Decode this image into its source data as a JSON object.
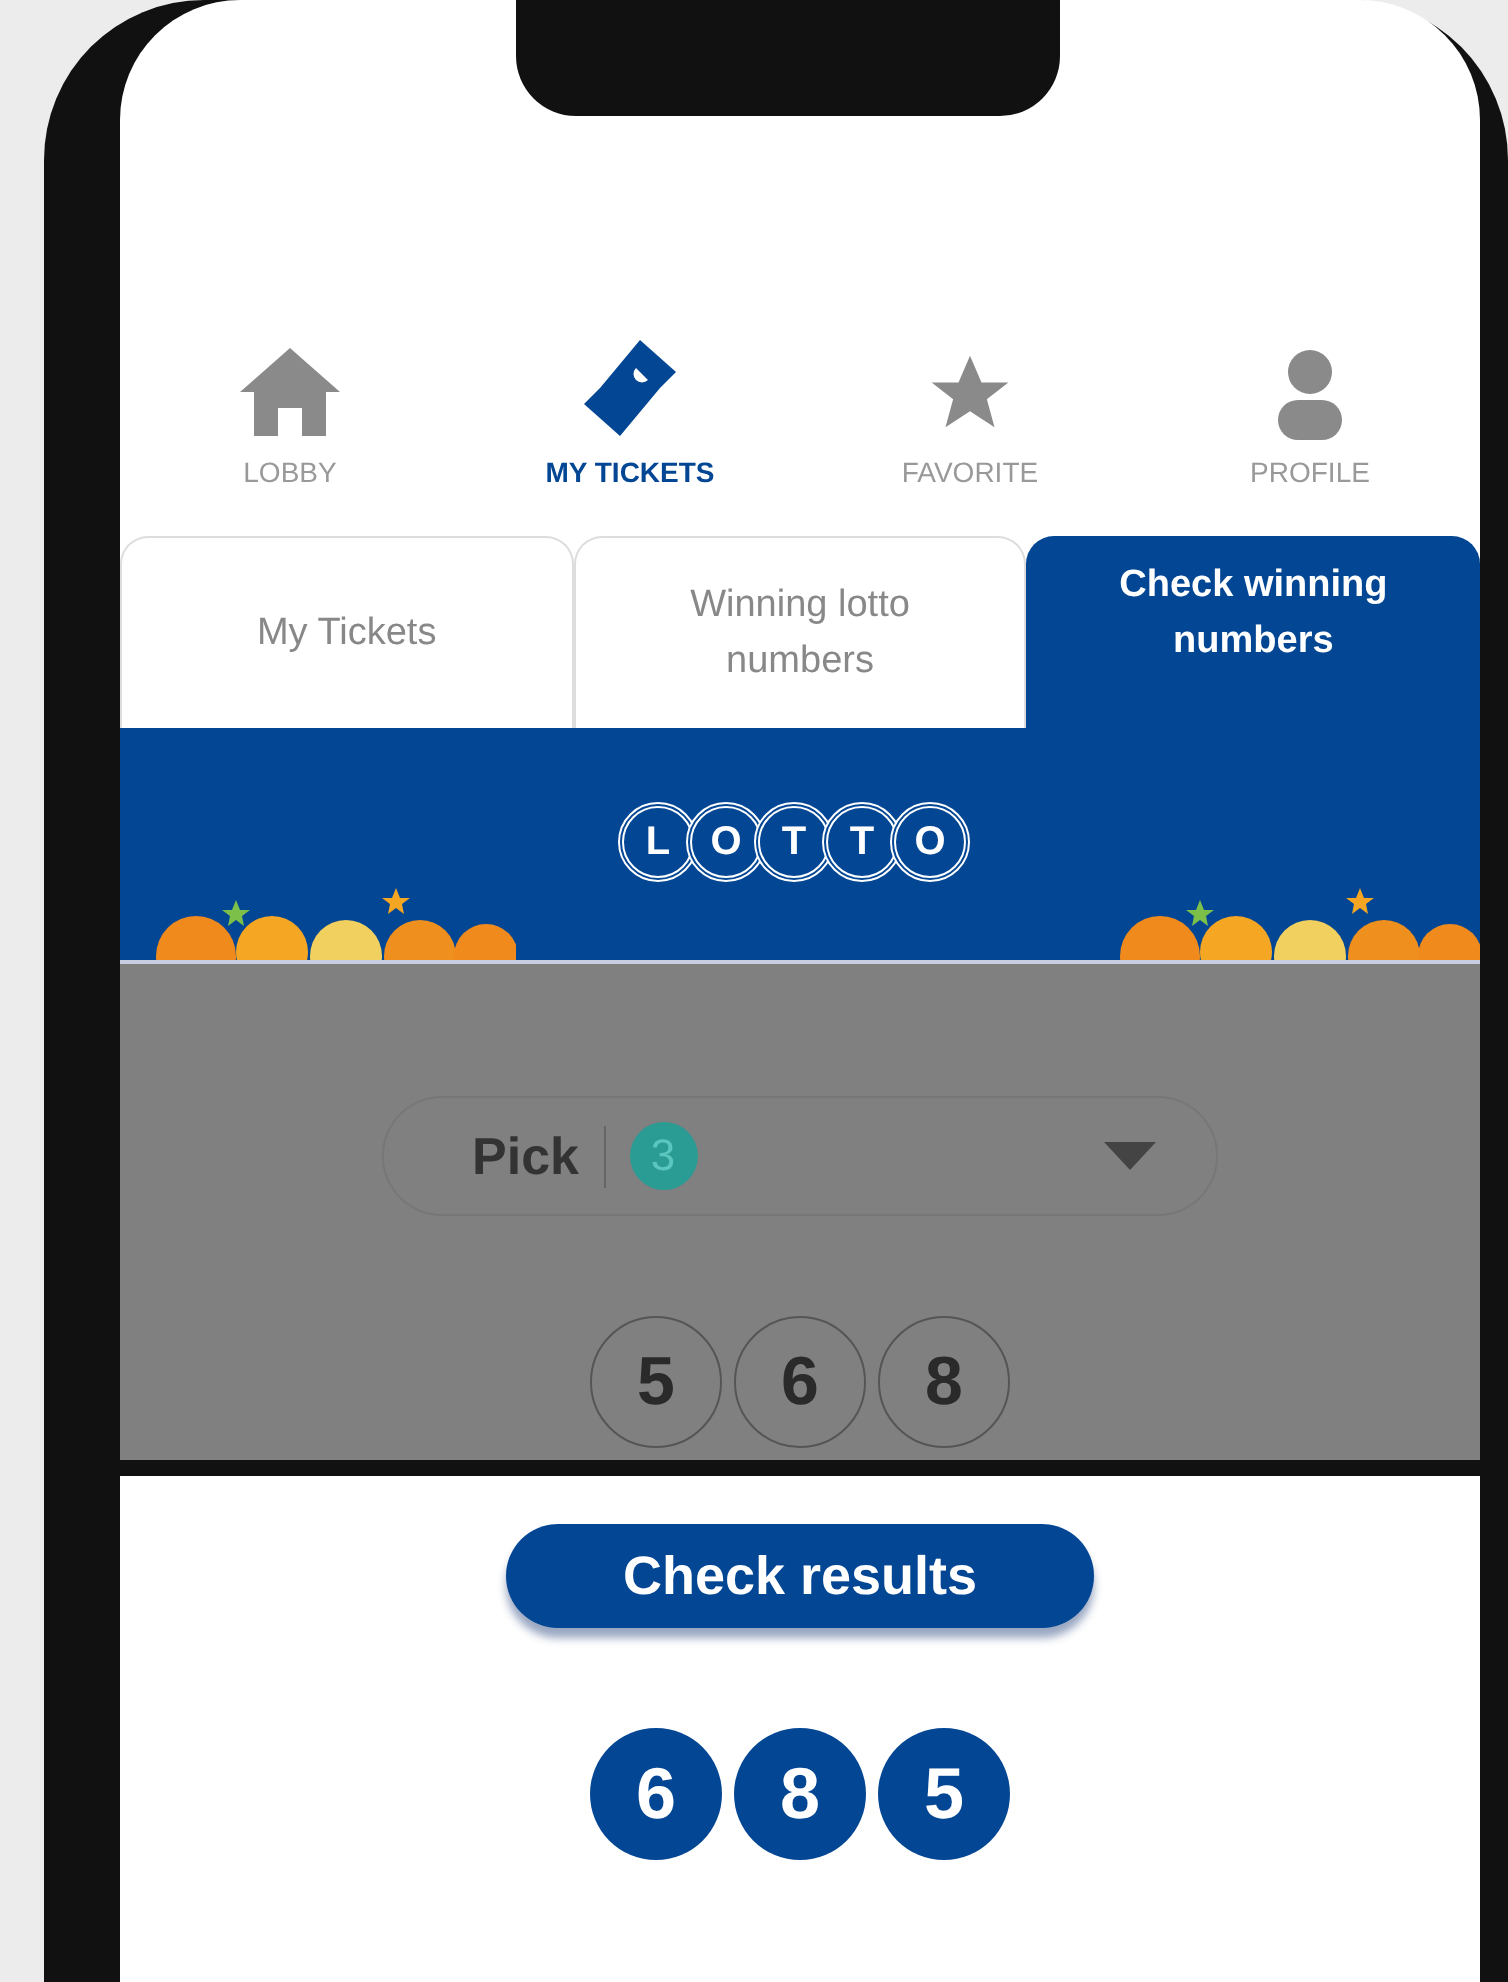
{
  "nav": [
    {
      "label": "LOBBY",
      "selected": false
    },
    {
      "label": "MY TICKETS",
      "selected": true
    },
    {
      "label": "FAVORITE",
      "selected": false
    },
    {
      "label": "PROFILE",
      "selected": false
    }
  ],
  "tabs": [
    {
      "label": "My Tickets",
      "selected": false
    },
    {
      "label": "Winning lotto numbers",
      "selected": false
    },
    {
      "label": "Check winning numbers",
      "selected": true
    }
  ],
  "logo_letters": [
    "L",
    "O",
    "T",
    "T",
    "O"
  ],
  "pick": {
    "label": "Pick",
    "count": "3"
  },
  "picked_numbers": [
    "5",
    "6",
    "8"
  ],
  "check_button": "Check results",
  "result_numbers": [
    "6",
    "8",
    "5"
  ]
}
